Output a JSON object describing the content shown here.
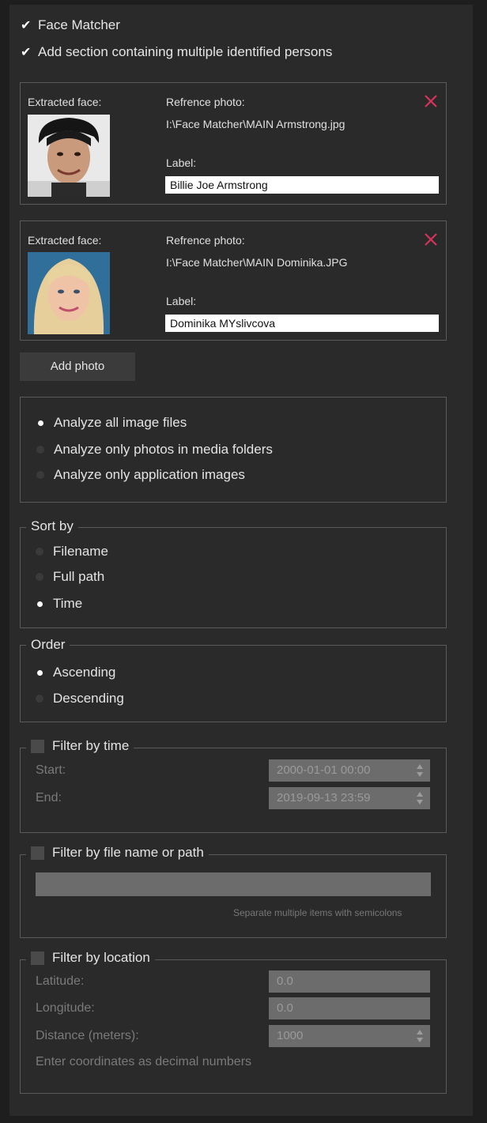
{
  "options": {
    "face_matcher": {
      "label": "Face Matcher",
      "checked": true
    },
    "multiple_persons": {
      "label": "Add section containing multiple identified persons",
      "checked": true
    }
  },
  "faces": [
    {
      "extracted_label": "Extracted face:",
      "reference_label": "Refrence photo:",
      "reference_path": "I:\\Face Matcher\\MAIN Armstrong.jpg",
      "label_caption": "Label:",
      "label_value": "Billie Joe Armstrong"
    },
    {
      "extracted_label": "Extracted face:",
      "reference_label": "Refrence photo:",
      "reference_path": "I:\\Face Matcher\\MAIN Dominika.JPG",
      "label_caption": "Label:",
      "label_value": "Dominika MYslivcova"
    }
  ],
  "add_photo_label": "Add photo",
  "analyze": {
    "options": [
      "Analyze all image files",
      "Analyze only photos in media folders",
      "Analyze only application images"
    ],
    "selected": 0
  },
  "sort_by": {
    "title": "Sort by",
    "options": [
      "Filename",
      "Full path",
      "Time"
    ],
    "selected": 2
  },
  "order": {
    "title": "Order",
    "options": [
      "Ascending",
      "Descending"
    ],
    "selected": 0
  },
  "filter_time": {
    "title": "Filter by time",
    "checked": false,
    "start_label": "Start:",
    "start_value": "2000-01-01 00:00",
    "end_label": "End:",
    "end_value": "2019-09-13 23:59"
  },
  "filter_name": {
    "title": "Filter by file name or path",
    "checked": false,
    "value": "",
    "hint": "Separate multiple items with semicolons"
  },
  "filter_location": {
    "title": "Filter by location",
    "checked": false,
    "latitude_label": "Latitude:",
    "latitude_value": "0.0",
    "longitude_label": "Longitude:",
    "longitude_value": "0.0",
    "distance_label": "Distance (meters):",
    "distance_value": "1000",
    "hint": "Enter coordinates as decimal numbers"
  },
  "colors": {
    "background": "#2a2a2a",
    "close_icon": "#d6335a",
    "input_bg": "#ffffff",
    "disabled_field": "#6c6c6c"
  }
}
